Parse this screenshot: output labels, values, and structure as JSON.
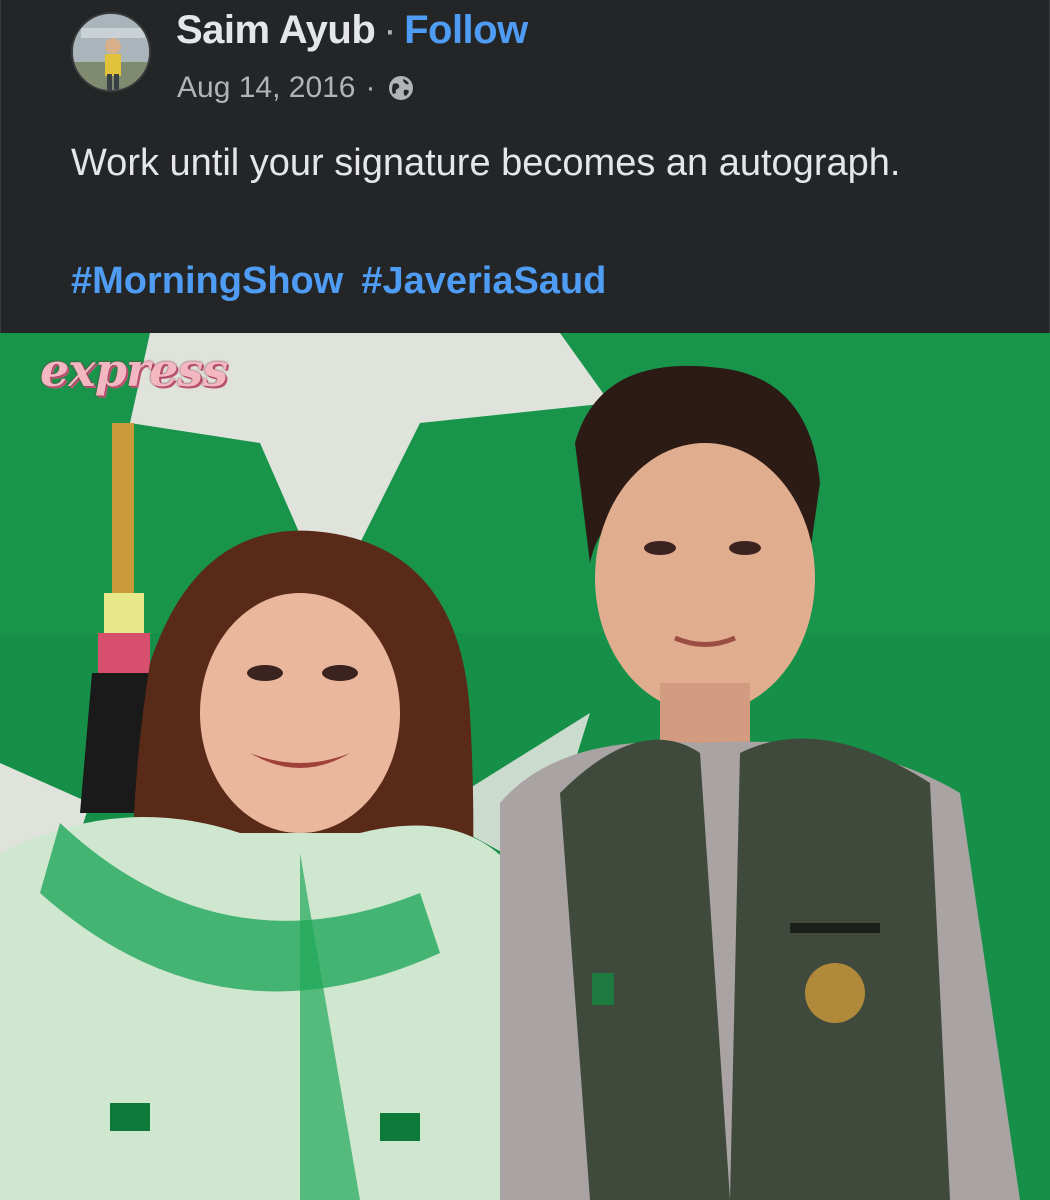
{
  "post": {
    "author": "Saim Ayub",
    "separator": "·",
    "follow_label": "Follow",
    "date": "Aug 14, 2016",
    "audience_icon": "globe-icon",
    "text": "Work until your signature becomes an autograph.",
    "hashtags": [
      "#MorningShow",
      "#JaveriaSaud"
    ]
  },
  "photo": {
    "brand_logo": "express"
  },
  "colors": {
    "post_bg": "#242526",
    "text": "#e4e6eb",
    "muted": "#b0b3b8",
    "link": "#4f9cf4",
    "photo_green": "#138a40"
  }
}
